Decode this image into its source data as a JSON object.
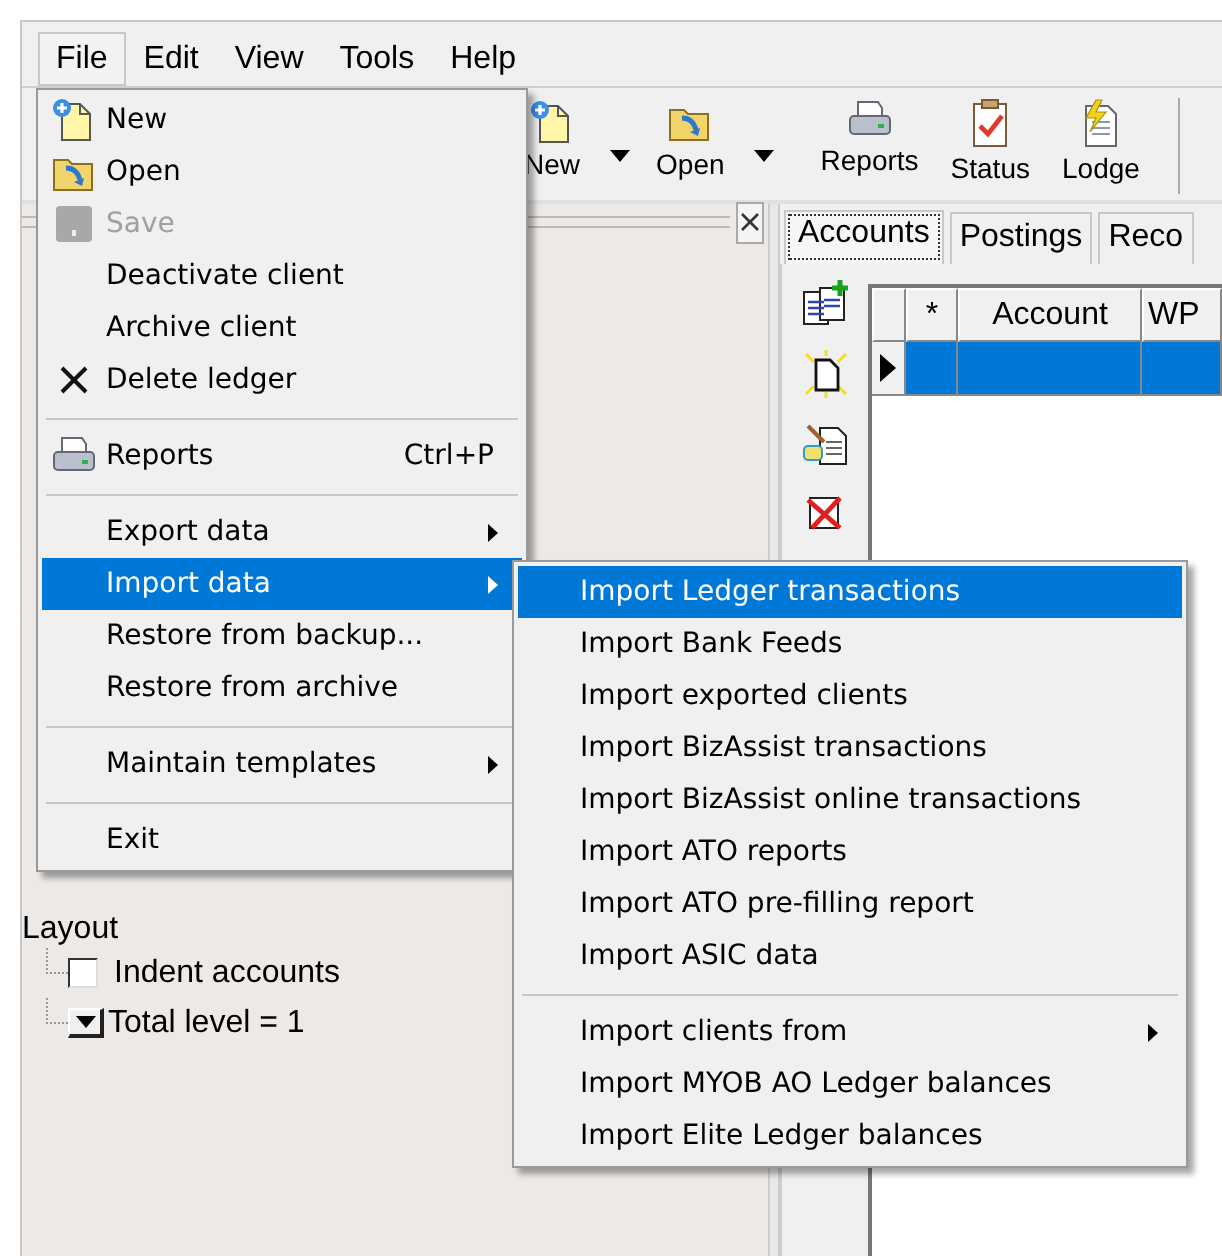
{
  "menubar": [
    {
      "label": "File",
      "selected": true
    },
    {
      "label": "Edit",
      "selected": false
    },
    {
      "label": "View",
      "selected": false
    },
    {
      "label": "Tools",
      "selected": false
    },
    {
      "label": "Help",
      "selected": false
    }
  ],
  "toolbar": [
    {
      "label": "New",
      "dropdown": true
    },
    {
      "label": "Open",
      "dropdown": true
    },
    {
      "label": "Reports",
      "dropdown": false
    },
    {
      "label": "Status",
      "dropdown": false
    },
    {
      "label": "Lodge",
      "dropdown": false
    }
  ],
  "layout_tree": {
    "label": "Layout",
    "children": [
      {
        "kind": "checkbox",
        "label": "Indent accounts",
        "checked": false
      },
      {
        "kind": "dropdown",
        "label": "Total level = 1"
      }
    ]
  },
  "tabs": [
    {
      "label": "Accounts",
      "selected": true
    },
    {
      "label": "Postings",
      "selected": false
    },
    {
      "label": "Reco",
      "selected": false
    }
  ],
  "grid": {
    "columns": [
      "*",
      "Account",
      "WP"
    ],
    "rows": [
      {
        "selected": true
      }
    ]
  },
  "file_menu": [
    {
      "kind": "item",
      "label": "New",
      "disabled": false,
      "selected": false,
      "submenu": false
    },
    {
      "kind": "item",
      "label": "Open",
      "disabled": false,
      "selected": false,
      "submenu": false
    },
    {
      "kind": "item",
      "label": "Save",
      "disabled": true,
      "selected": false,
      "submenu": false
    },
    {
      "kind": "item",
      "label": "Deactivate client",
      "disabled": false,
      "selected": false,
      "submenu": false
    },
    {
      "kind": "item",
      "label": "Archive client",
      "disabled": false,
      "selected": false,
      "submenu": false
    },
    {
      "kind": "item",
      "label": "Delete ledger",
      "disabled": false,
      "selected": false,
      "submenu": false
    },
    {
      "kind": "separator"
    },
    {
      "kind": "item",
      "label": "Reports",
      "shortcut": "Ctrl+P",
      "disabled": false,
      "selected": false,
      "submenu": false
    },
    {
      "kind": "separator"
    },
    {
      "kind": "item",
      "label": "Export data",
      "disabled": false,
      "selected": false,
      "submenu": true
    },
    {
      "kind": "item",
      "label": "Import data",
      "disabled": false,
      "selected": true,
      "submenu": true
    },
    {
      "kind": "item",
      "label": "Restore from backup...",
      "disabled": false,
      "selected": false,
      "submenu": false
    },
    {
      "kind": "item",
      "label": "Restore from archive",
      "disabled": false,
      "selected": false,
      "submenu": false
    },
    {
      "kind": "separator"
    },
    {
      "kind": "item",
      "label": "Maintain templates",
      "disabled": false,
      "selected": false,
      "submenu": true
    },
    {
      "kind": "separator"
    },
    {
      "kind": "item",
      "label": "Exit",
      "disabled": false,
      "selected": false,
      "submenu": false
    }
  ],
  "import_submenu": [
    {
      "kind": "item",
      "label": "Import Ledger transactions",
      "selected": true,
      "submenu": false
    },
    {
      "kind": "item",
      "label": "Import Bank Feeds",
      "selected": false,
      "submenu": false
    },
    {
      "kind": "item",
      "label": "Import exported clients",
      "selected": false,
      "submenu": false
    },
    {
      "kind": "item",
      "label": "Import BizAssist transactions",
      "selected": false,
      "submenu": false
    },
    {
      "kind": "item",
      "label": "Import BizAssist online transactions",
      "selected": false,
      "submenu": false
    },
    {
      "kind": "item",
      "label": "Import ATO reports",
      "selected": false,
      "submenu": false
    },
    {
      "kind": "item",
      "label": "Import ATO pre-filling report",
      "selected": false,
      "submenu": false
    },
    {
      "kind": "item",
      "label": "Import ASIC data",
      "selected": false,
      "submenu": false
    },
    {
      "kind": "separator"
    },
    {
      "kind": "item",
      "label": "Import clients from",
      "selected": false,
      "submenu": true
    },
    {
      "kind": "item",
      "label": "Import MYOB AO Ledger balances",
      "selected": false,
      "submenu": false
    },
    {
      "kind": "item",
      "label": "Import Elite Ledger balances",
      "selected": false,
      "submenu": false
    }
  ]
}
